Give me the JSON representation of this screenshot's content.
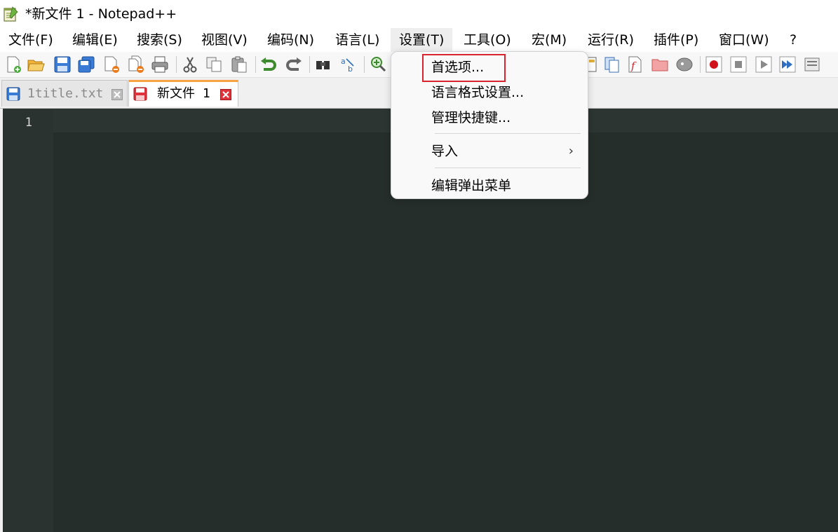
{
  "window": {
    "title": "*新文件 1 - Notepad++"
  },
  "menubar": {
    "items": [
      "文件(F)",
      "编辑(E)",
      "搜索(S)",
      "视图(V)",
      "编码(N)",
      "语言(L)",
      "设置(T)",
      "工具(O)",
      "宏(M)",
      "运行(R)",
      "插件(P)",
      "窗口(W)",
      "?"
    ]
  },
  "tabs": [
    {
      "label": "1title.txt",
      "active": false
    },
    {
      "label": "新文件 1",
      "active": true
    }
  ],
  "editor": {
    "line_numbers": [
      "1"
    ]
  },
  "dropdown": {
    "items": [
      {
        "label": "首选项...",
        "highlighted": true
      },
      {
        "label": "语言格式设置..."
      },
      {
        "label": "管理快捷键..."
      },
      {
        "label": "导入",
        "submenu_arrow": "›"
      },
      {
        "label": "编辑弹出菜单"
      }
    ]
  },
  "colors": {
    "editor_bg": "#262e2b",
    "tab_active_accent": "#f6a345",
    "highlight_border": "#d9232d",
    "save_icon_blue": "#3a7bd5",
    "save_icon_red": "#e0323a"
  }
}
